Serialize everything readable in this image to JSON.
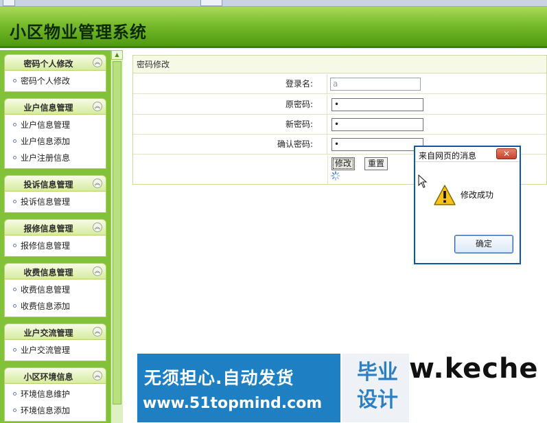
{
  "app": {
    "title": "小区物业管理系统"
  },
  "sidebar": {
    "groups": [
      {
        "title": "密码个人修改",
        "items": [
          "密码个人修改"
        ]
      },
      {
        "title": "业户信息管理",
        "items": [
          "业户信息管理",
          "业户信息添加",
          "业户注册信息"
        ]
      },
      {
        "title": "投诉信息管理",
        "items": [
          "投诉信息管理"
        ]
      },
      {
        "title": "报修信息管理",
        "items": [
          "报修信息管理"
        ]
      },
      {
        "title": "收费信息管理",
        "items": [
          "收费信息管理",
          "收费信息添加"
        ]
      },
      {
        "title": "业户交流管理",
        "items": [
          "业户交流管理"
        ]
      },
      {
        "title": "小区环境信息",
        "items": [
          "环境信息维护",
          "环境信息添加"
        ]
      }
    ]
  },
  "form": {
    "title": "密码修改",
    "login_label": "登录名:",
    "login_value": "a",
    "old_label": "原密码:",
    "old_value": "•",
    "new_label": "新密码:",
    "new_value": "•",
    "confirm_label": "确认密码:",
    "confirm_value": "•",
    "submit_label": "修改",
    "reset_label": "重置"
  },
  "dialog": {
    "title": "来自网页的消息",
    "message": "修改成功",
    "ok_label": "确定",
    "close_glyph": "✕"
  },
  "banner": {
    "line1": "无须担心.自动发货",
    "line2": "www.51topmind.com",
    "right_text": "毕业设计",
    "watermark": "w.keche"
  },
  "colors": {
    "header": "#5fa81c",
    "sidebar": "#82c23a",
    "dialog_border": "#0b58a4",
    "banner": "#1e80c3"
  }
}
